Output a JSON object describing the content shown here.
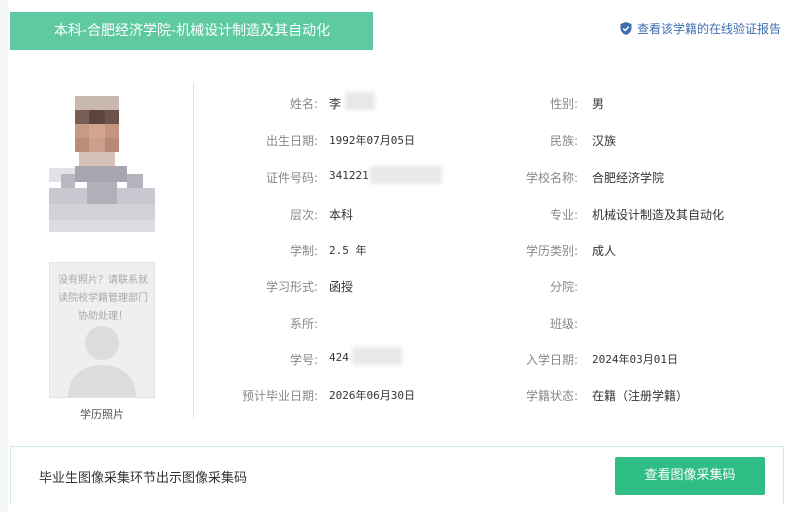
{
  "header": {
    "title": "本科-合肥经济学院-机械设计制造及其自动化",
    "verify_link": "查看该学籍的在线验证报告"
  },
  "photos": {
    "no_photo_text": "没有照片？请联系就读院校学籍管理部门协助处理！",
    "caption": "学历照片"
  },
  "fields": {
    "name": {
      "label": "姓名:",
      "value": "李"
    },
    "gender": {
      "label": "性别:",
      "value": "男"
    },
    "birth": {
      "label": "出生日期:",
      "value": "1992年07月05日"
    },
    "ethnicity": {
      "label": "民族:",
      "value": "汉族"
    },
    "id_number": {
      "label": "证件号码:",
      "value": "341221"
    },
    "school": {
      "label": "学校名称:",
      "value": "合肥经济学院"
    },
    "level": {
      "label": "层次:",
      "value": "本科"
    },
    "major": {
      "label": "专业:",
      "value": "机械设计制造及其自动化"
    },
    "duration": {
      "label": "学制:",
      "value": "2.5 年"
    },
    "edu_type": {
      "label": "学历类别:",
      "value": "成人"
    },
    "study_form": {
      "label": "学习形式:",
      "value": "函授"
    },
    "branch": {
      "label": "分院:",
      "value": ""
    },
    "department": {
      "label": "系所:",
      "value": ""
    },
    "class_name": {
      "label": "班级:",
      "value": ""
    },
    "student_no": {
      "label": "学号:",
      "value": "424"
    },
    "enroll_date": {
      "label": "入学日期:",
      "value": "2024年03月01日"
    },
    "grad_date": {
      "label": "预计毕业日期:",
      "value": "2026年06月30日"
    },
    "status": {
      "label": "学籍状态:",
      "value": "在籍（注册学籍）"
    }
  },
  "bottom": {
    "text": "毕业生图像采集环节出示图像采集码",
    "button": "查看图像采集码"
  },
  "colors": {
    "accent": "#5fc9a2",
    "button": "#2ebd85",
    "link": "#3e6eb0"
  }
}
